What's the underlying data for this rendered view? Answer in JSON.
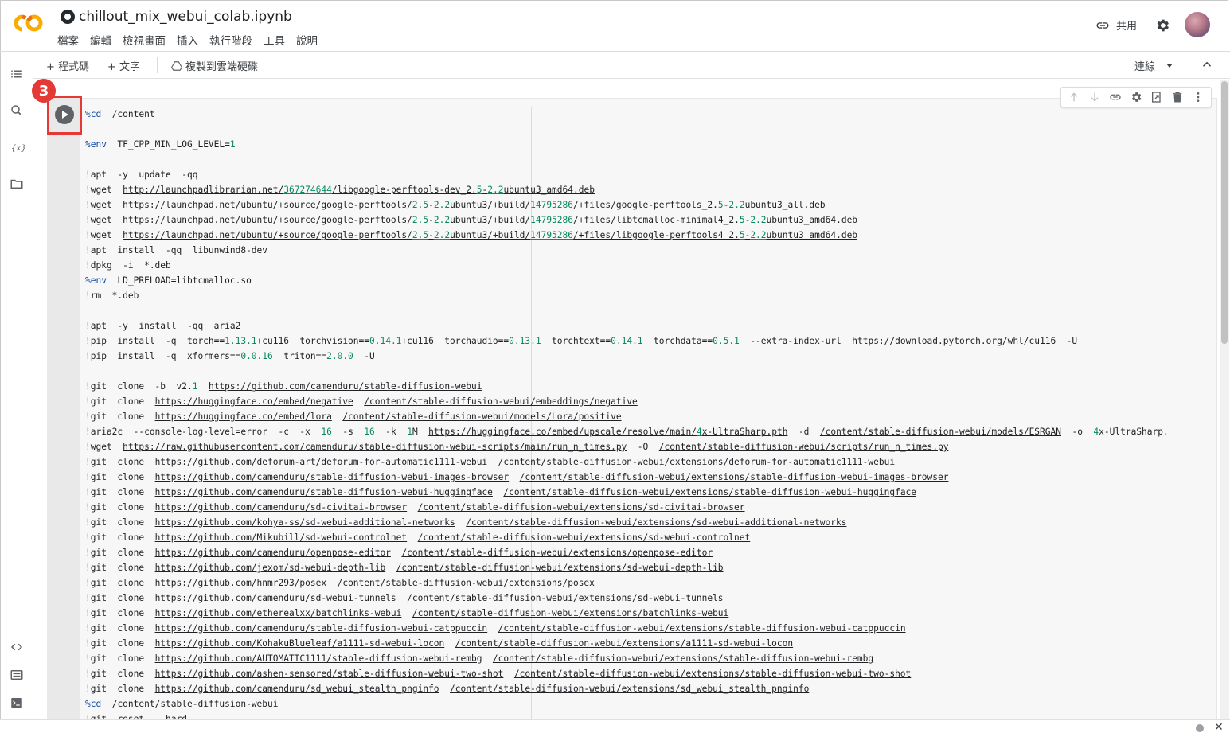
{
  "header": {
    "title": "chillout_mix_webui_colab.ipynb",
    "menu": [
      "檔案",
      "編輯",
      "檢視畫面",
      "插入",
      "執行階段",
      "工具",
      "說明"
    ],
    "share_label": "共用"
  },
  "toolbar": {
    "add_code": "+ 程式碼",
    "add_text": "+ 文字",
    "copy_to_drive": "複製到雲端硬碟",
    "connect": "連線"
  },
  "annotation": {
    "badge": "3"
  },
  "icons": {
    "logo": "colab-logo-icon",
    "github": "github-icon",
    "share": "link-icon",
    "settings": "gear-icon",
    "rail": [
      "toc-icon",
      "search-icon",
      "variables-icon",
      "folder-icon",
      "code-snippets-icon",
      "command-palette-icon",
      "terminal-icon"
    ],
    "cell_toolbar": [
      "arrow-up-icon",
      "arrow-down-icon",
      "link-icon",
      "gear-icon",
      "mirror-cell-icon",
      "delete-icon",
      "more-vert-icon"
    ]
  },
  "colors": {
    "accent_red": "#e53935",
    "magic": "#0d47a1",
    "number": "#09885a"
  },
  "code_lines": [
    [
      {
        "t": "%cd",
        "c": "mg"
      },
      {
        "t": "  /content"
      }
    ],
    [],
    [
      {
        "t": "%env",
        "c": "mg"
      },
      {
        "t": "  TF_CPP_MIN_LOG_LEVEL="
      },
      {
        "t": "1",
        "c": "num"
      }
    ],
    [],
    [
      {
        "t": "!apt  -y  update  -qq"
      }
    ],
    [
      {
        "t": "!wget  "
      },
      {
        "t": "http://launchpadlibrarian.net/",
        "c": "u"
      },
      {
        "t": "367274644",
        "c": "u num"
      },
      {
        "t": "/libgoogle-perftools-dev_2.",
        "c": "u"
      },
      {
        "t": "5",
        "c": "u num"
      },
      {
        "t": "-",
        "c": "u"
      },
      {
        "t": "2.2",
        "c": "u num"
      },
      {
        "t": "ubuntu3_amd64.deb",
        "c": "u"
      }
    ],
    [
      {
        "t": "!wget  "
      },
      {
        "t": "https://launchpad.net/ubuntu/+source/google-perftools/",
        "c": "u"
      },
      {
        "t": "2.5",
        "c": "u num"
      },
      {
        "t": "-",
        "c": "u"
      },
      {
        "t": "2.2",
        "c": "u num"
      },
      {
        "t": "ubuntu3/+build/",
        "c": "u"
      },
      {
        "t": "14795286",
        "c": "u num"
      },
      {
        "t": "/+files/google-perftools_2.",
        "c": "u"
      },
      {
        "t": "5",
        "c": "u num"
      },
      {
        "t": "-",
        "c": "u"
      },
      {
        "t": "2.2",
        "c": "u num"
      },
      {
        "t": "ubuntu3_all.deb",
        "c": "u"
      }
    ],
    [
      {
        "t": "!wget  "
      },
      {
        "t": "https://launchpad.net/ubuntu/+source/google-perftools/",
        "c": "u"
      },
      {
        "t": "2.5",
        "c": "u num"
      },
      {
        "t": "-",
        "c": "u"
      },
      {
        "t": "2.2",
        "c": "u num"
      },
      {
        "t": "ubuntu3/+build/",
        "c": "u"
      },
      {
        "t": "14795286",
        "c": "u num"
      },
      {
        "t": "/+files/libtcmalloc-minimal4_2.",
        "c": "u"
      },
      {
        "t": "5",
        "c": "u num"
      },
      {
        "t": "-",
        "c": "u"
      },
      {
        "t": "2.2",
        "c": "u num"
      },
      {
        "t": "ubuntu3_amd64.deb",
        "c": "u"
      }
    ],
    [
      {
        "t": "!wget  "
      },
      {
        "t": "https://launchpad.net/ubuntu/+source/google-perftools/",
        "c": "u"
      },
      {
        "t": "2.5",
        "c": "u num"
      },
      {
        "t": "-",
        "c": "u"
      },
      {
        "t": "2.2",
        "c": "u num"
      },
      {
        "t": "ubuntu3/+build/",
        "c": "u"
      },
      {
        "t": "14795286",
        "c": "u num"
      },
      {
        "t": "/+files/libgoogle-perftools4_2.",
        "c": "u"
      },
      {
        "t": "5",
        "c": "u num"
      },
      {
        "t": "-",
        "c": "u"
      },
      {
        "t": "2.2",
        "c": "u num"
      },
      {
        "t": "ubuntu3_amd64.deb",
        "c": "u"
      }
    ],
    [
      {
        "t": "!apt  install  -qq  libunwind8-dev"
      }
    ],
    [
      {
        "t": "!dpkg  -i  *.deb"
      }
    ],
    [
      {
        "t": "%env",
        "c": "mg"
      },
      {
        "t": "  LD_PRELOAD=libtcmalloc.so"
      }
    ],
    [
      {
        "t": "!rm  *.deb"
      }
    ],
    [],
    [
      {
        "t": "!apt  -y  install  -qq  aria2"
      }
    ],
    [
      {
        "t": "!pip  install  -q  torch=="
      },
      {
        "t": "1.13.1",
        "c": "num"
      },
      {
        "t": "+cu116  torchvision=="
      },
      {
        "t": "0.14.1",
        "c": "num"
      },
      {
        "t": "+cu116  torchaudio=="
      },
      {
        "t": "0.13.1",
        "c": "num"
      },
      {
        "t": "  torchtext=="
      },
      {
        "t": "0.14.1",
        "c": "num"
      },
      {
        "t": "  torchdata=="
      },
      {
        "t": "0.5.1",
        "c": "num"
      },
      {
        "t": "  --extra-index-url  "
      },
      {
        "t": "https://download.pytorch.org/whl/cu116",
        "c": "u"
      },
      {
        "t": "  -U"
      }
    ],
    [
      {
        "t": "!pip  install  -q  xformers=="
      },
      {
        "t": "0.0.16",
        "c": "num"
      },
      {
        "t": "  triton=="
      },
      {
        "t": "2.0.0",
        "c": "num"
      },
      {
        "t": "  -U"
      }
    ],
    [],
    [
      {
        "t": "!git  clone  -b  v2."
      },
      {
        "t": "1",
        "c": "num"
      },
      {
        "t": "  "
      },
      {
        "t": "https://github.com/camenduru/stable-diffusion-webui",
        "c": "u"
      }
    ],
    [
      {
        "t": "!git  clone  "
      },
      {
        "t": "https://huggingface.co/embed/negative",
        "c": "u"
      },
      {
        "t": "  "
      },
      {
        "t": "/content/stable-diffusion-webui/embeddings/negative",
        "c": "u"
      }
    ],
    [
      {
        "t": "!git  clone  "
      },
      {
        "t": "https://huggingface.co/embed/lora",
        "c": "u"
      },
      {
        "t": "  "
      },
      {
        "t": "/content/stable-diffusion-webui/models/Lora/positive",
        "c": "u"
      }
    ],
    [
      {
        "t": "!aria2c  --console-log-level=error  -c  -x  "
      },
      {
        "t": "16",
        "c": "num"
      },
      {
        "t": "  -s  "
      },
      {
        "t": "16",
        "c": "num"
      },
      {
        "t": "  -k  "
      },
      {
        "t": "1",
        "c": "num"
      },
      {
        "t": "M  "
      },
      {
        "t": "https://huggingface.co/embed/upscale/resolve/main/",
        "c": "u"
      },
      {
        "t": "4",
        "c": "u num"
      },
      {
        "t": "x-UltraSharp.pth",
        "c": "u"
      },
      {
        "t": "  -d  "
      },
      {
        "t": "/content/stable-diffusion-webui/models/ESRGAN",
        "c": "u"
      },
      {
        "t": "  -o  "
      },
      {
        "t": "4",
        "c": "num"
      },
      {
        "t": "x-UltraSharp."
      }
    ],
    [
      {
        "t": "!wget  "
      },
      {
        "t": "https://raw.githubusercontent.com/camenduru/stable-diffusion-webui-scripts/main/run_n_times.py",
        "c": "u"
      },
      {
        "t": "  -O  "
      },
      {
        "t": "/content/stable-diffusion-webui/scripts/run_n_times.py",
        "c": "u"
      }
    ],
    [
      {
        "t": "!git  clone  "
      },
      {
        "t": "https://github.com/deforum-art/deforum-for-automatic1111-webui",
        "c": "u"
      },
      {
        "t": "  "
      },
      {
        "t": "/content/stable-diffusion-webui/extensions/deforum-for-automatic1111-webui",
        "c": "u"
      }
    ],
    [
      {
        "t": "!git  clone  "
      },
      {
        "t": "https://github.com/camenduru/stable-diffusion-webui-images-browser",
        "c": "u"
      },
      {
        "t": "  "
      },
      {
        "t": "/content/stable-diffusion-webui/extensions/stable-diffusion-webui-images-browser",
        "c": "u"
      }
    ],
    [
      {
        "t": "!git  clone  "
      },
      {
        "t": "https://github.com/camenduru/stable-diffusion-webui-huggingface",
        "c": "u"
      },
      {
        "t": "  "
      },
      {
        "t": "/content/stable-diffusion-webui/extensions/stable-diffusion-webui-huggingface",
        "c": "u"
      }
    ],
    [
      {
        "t": "!git  clone  "
      },
      {
        "t": "https://github.com/camenduru/sd-civitai-browser",
        "c": "u"
      },
      {
        "t": "  "
      },
      {
        "t": "/content/stable-diffusion-webui/extensions/sd-civitai-browser",
        "c": "u"
      }
    ],
    [
      {
        "t": "!git  clone  "
      },
      {
        "t": "https://github.com/kohya-ss/sd-webui-additional-networks",
        "c": "u"
      },
      {
        "t": "  "
      },
      {
        "t": "/content/stable-diffusion-webui/extensions/sd-webui-additional-networks",
        "c": "u"
      }
    ],
    [
      {
        "t": "!git  clone  "
      },
      {
        "t": "https://github.com/Mikubill/sd-webui-controlnet",
        "c": "u"
      },
      {
        "t": "  "
      },
      {
        "t": "/content/stable-diffusion-webui/extensions/sd-webui-controlnet",
        "c": "u"
      }
    ],
    [
      {
        "t": "!git  clone  "
      },
      {
        "t": "https://github.com/camenduru/openpose-editor",
        "c": "u"
      },
      {
        "t": "  "
      },
      {
        "t": "/content/stable-diffusion-webui/extensions/openpose-editor",
        "c": "u"
      }
    ],
    [
      {
        "t": "!git  clone  "
      },
      {
        "t": "https://github.com/jexom/sd-webui-depth-lib",
        "c": "u"
      },
      {
        "t": "  "
      },
      {
        "t": "/content/stable-diffusion-webui/extensions/sd-webui-depth-lib",
        "c": "u"
      }
    ],
    [
      {
        "t": "!git  clone  "
      },
      {
        "t": "https://github.com/hnmr293/posex",
        "c": "u"
      },
      {
        "t": "  "
      },
      {
        "t": "/content/stable-diffusion-webui/extensions/posex",
        "c": "u"
      }
    ],
    [
      {
        "t": "!git  clone  "
      },
      {
        "t": "https://github.com/camenduru/sd-webui-tunnels",
        "c": "u"
      },
      {
        "t": "  "
      },
      {
        "t": "/content/stable-diffusion-webui/extensions/sd-webui-tunnels",
        "c": "u"
      }
    ],
    [
      {
        "t": "!git  clone  "
      },
      {
        "t": "https://github.com/etherealxx/batchlinks-webui",
        "c": "u"
      },
      {
        "t": "  "
      },
      {
        "t": "/content/stable-diffusion-webui/extensions/batchlinks-webui",
        "c": "u"
      }
    ],
    [
      {
        "t": "!git  clone  "
      },
      {
        "t": "https://github.com/camenduru/stable-diffusion-webui-catppuccin",
        "c": "u"
      },
      {
        "t": "  "
      },
      {
        "t": "/content/stable-diffusion-webui/extensions/stable-diffusion-webui-catppuccin",
        "c": "u"
      }
    ],
    [
      {
        "t": "!git  clone  "
      },
      {
        "t": "https://github.com/KohakuBlueleaf/a1111-sd-webui-locon",
        "c": "u"
      },
      {
        "t": "  "
      },
      {
        "t": "/content/stable-diffusion-webui/extensions/a1111-sd-webui-locon",
        "c": "u"
      }
    ],
    [
      {
        "t": "!git  clone  "
      },
      {
        "t": "https://github.com/AUTOMATIC1111/stable-diffusion-webui-rembg",
        "c": "u"
      },
      {
        "t": "  "
      },
      {
        "t": "/content/stable-diffusion-webui/extensions/stable-diffusion-webui-rembg",
        "c": "u"
      }
    ],
    [
      {
        "t": "!git  clone  "
      },
      {
        "t": "https://github.com/ashen-sensored/stable-diffusion-webui-two-shot",
        "c": "u"
      },
      {
        "t": "  "
      },
      {
        "t": "/content/stable-diffusion-webui/extensions/stable-diffusion-webui-two-shot",
        "c": "u"
      }
    ],
    [
      {
        "t": "!git  clone  "
      },
      {
        "t": "https://github.com/camenduru/sd_webui_stealth_pnginfo",
        "c": "u"
      },
      {
        "t": "  "
      },
      {
        "t": "/content/stable-diffusion-webui/extensions/sd_webui_stealth_pnginfo",
        "c": "u"
      }
    ],
    [
      {
        "t": "%cd",
        "c": "mg"
      },
      {
        "t": "  "
      },
      {
        "t": "/content/stable-diffusion-webui",
        "c": "u"
      }
    ],
    [
      {
        "t": "!git  reset  --hard"
      }
    ]
  ]
}
